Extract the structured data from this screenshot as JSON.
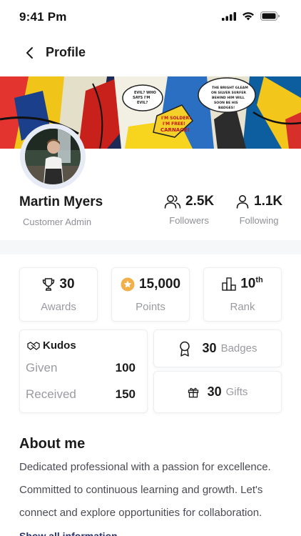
{
  "status": {
    "time": "9:41 Pm"
  },
  "header": {
    "title": "Profile"
  },
  "cover": {
    "bubble_1": "EVIL? WHO SAYS I'M EVIL?",
    "bubble_2": "THE BRIGHT GLEAM ON SILVER SURFER BEHIND HIM WILL SOON BE HIS BADGES!",
    "bubble_3": "I'M SOLDER! I'M FREE! CARNAGE!"
  },
  "profile": {
    "name": "Martin Myers",
    "role": "Customer Admin",
    "followers": {
      "value": "2.5K",
      "label": "Followers"
    },
    "following": {
      "value": "1.1K",
      "label": "Following"
    }
  },
  "tiles": {
    "awards": {
      "value": "30",
      "label": "Awards"
    },
    "points": {
      "value": "15,000",
      "label": "Points"
    },
    "rank": {
      "value": "10",
      "suffix": "th",
      "label": "Rank"
    }
  },
  "kudos": {
    "title": "Kudos",
    "given_label": "Given",
    "given_value": "100",
    "received_label": "Received",
    "received_value": "150"
  },
  "badges": {
    "value": "30",
    "label": "Badges"
  },
  "gifts": {
    "value": "30",
    "label": "Gifts"
  },
  "about": {
    "title": "About me",
    "text": "Dedicated professional with a passion for excellence. Committed to continuous learning and growth. Let's connect and explore opportunities for collaboration.",
    "link": "Show all information"
  },
  "colors": {
    "accent": "#27346f",
    "points_coin": "#f2b04b",
    "muted": "#9a9ba1"
  },
  "icons": [
    "signal-icon",
    "wifi-icon",
    "battery-icon",
    "back-arrow-icon",
    "followers-icon",
    "following-icon",
    "trophy-icon",
    "coin-star-icon",
    "rank-icon",
    "kudos-handshake-icon",
    "badge-ribbon-icon",
    "gift-icon"
  ]
}
